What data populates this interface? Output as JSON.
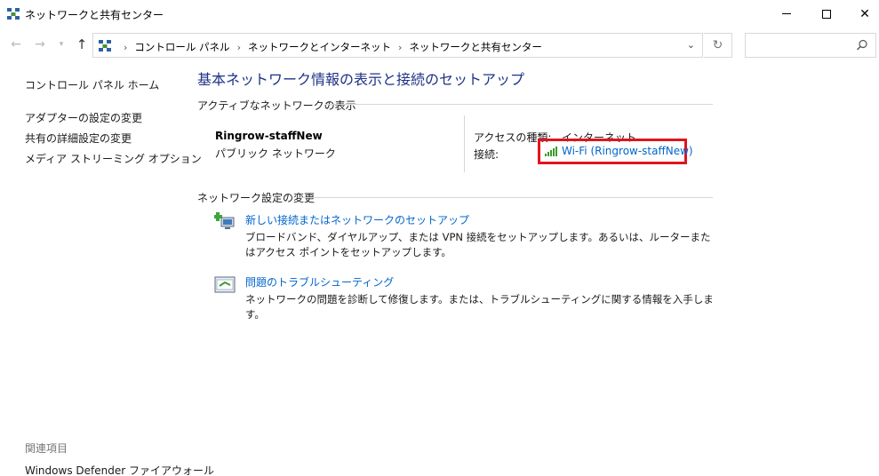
{
  "window": {
    "title": "ネットワークと共有センター",
    "icon": "network-center-icon"
  },
  "address": {
    "crumbs": [
      "コントロール パネル",
      "ネットワークとインターネット",
      "ネットワークと共有センター"
    ],
    "search_placeholder": ""
  },
  "sidebar": {
    "home": "コントロール パネル ホーム",
    "items": [
      {
        "label": "アダプターの設定の変更"
      },
      {
        "label": "共有の詳細設定の変更"
      },
      {
        "label": "メディア ストリーミング オプション"
      }
    ]
  },
  "related": {
    "heading": "関連項目",
    "items": [
      {
        "label": "Windows Defender ファイアウォール"
      }
    ]
  },
  "main": {
    "title": "基本ネットワーク情報の表示と接続のセットアップ",
    "active_section": "アクティブなネットワークの表示",
    "network": {
      "name": "Ringrow-staffNew",
      "type": "パブリック ネットワーク",
      "access_label": "アクセスの種類:",
      "access_value": "インターネット",
      "connection_label": "接続:",
      "connection_value": "Wi-Fi (Ringrow-staffNew)"
    },
    "settings_section": "ネットワーク設定の変更",
    "tasks": [
      {
        "icon": "new-connection-icon",
        "title": "新しい接続またはネットワークのセットアップ",
        "description": "ブロードバンド、ダイヤルアップ、または VPN 接続をセットアップします。あるいは、ルーターまたはアクセス ポイントをセットアップします。"
      },
      {
        "icon": "troubleshoot-icon",
        "title": "問題のトラブルシューティング",
        "description": "ネットワークの問題を診断して修復します。または、トラブルシューティングに関する情報を入手します。"
      }
    ]
  },
  "colors": {
    "link": "#0066cc",
    "title": "#1e3287",
    "highlight": "#e0141e"
  }
}
